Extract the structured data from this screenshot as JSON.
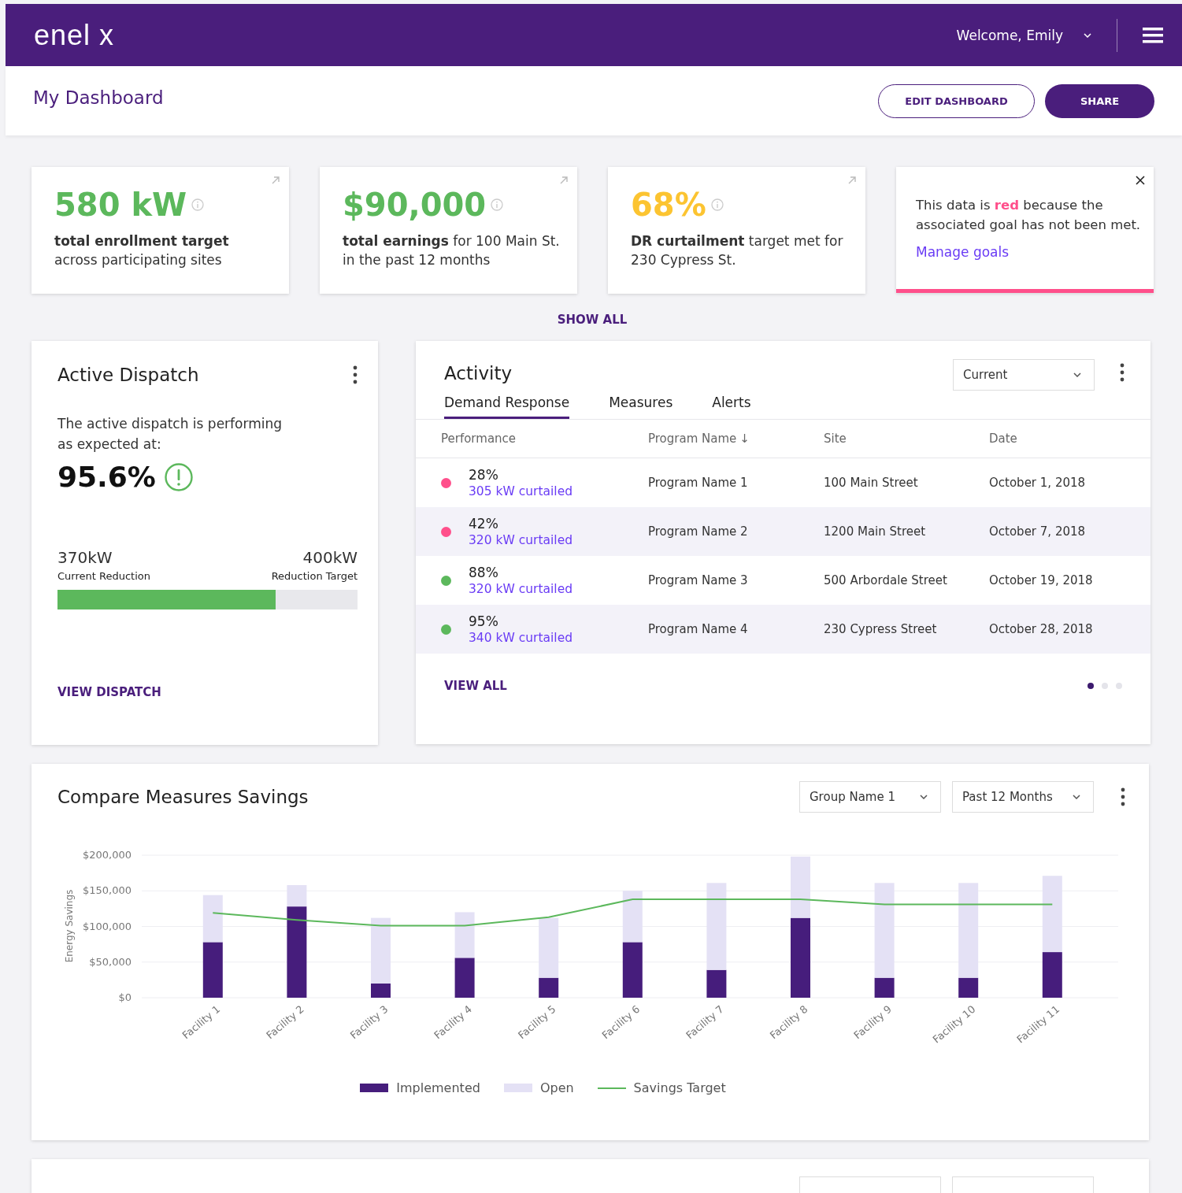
{
  "header": {
    "logo": "enel x",
    "welcome": "Welcome, Emily"
  },
  "page_title": "My Dashboard",
  "actions": [
    {
      "label": "EDIT DASHBOARD",
      "kind": "outline"
    },
    {
      "label": "SHARE",
      "kind": "filled"
    }
  ],
  "kpi_cards": [
    {
      "kind": "metric",
      "value": "580 kW",
      "color": "#5cb85c",
      "description": "**total enrollment target** across participating sites"
    },
    {
      "kind": "metric",
      "value": "$90,000",
      "color": "#5cb85c",
      "description": "**total earnings** for 100 Main St. in the past 12 months"
    },
    {
      "kind": "metric",
      "value": "68%",
      "color": "#fcc431",
      "description": "**DR curtailment** target met for 230 Cypress St."
    },
    {
      "kind": "notice",
      "text_before": "This data is ",
      "highlight": "red",
      "text_after": " because the associated goal has not been met.",
      "link": "Manage goals"
    }
  ],
  "show_all": "SHOW ALL",
  "dispatch": {
    "title": "Active Dispatch",
    "text": "The active dispatch is performing as expected at:",
    "value": "95.6%",
    "current_value": "370kW",
    "current_label": "Current Reduction",
    "target_value": "400kW",
    "target_label": "Reduction Target",
    "level": 0.727,
    "link": "VIEW DISPATCH"
  },
  "activity": {
    "title": "Activity",
    "dropdown": "Current",
    "tabs": [
      {
        "label": "Demand Response",
        "selected": true
      },
      {
        "label": "Measures",
        "selected": false
      },
      {
        "label": "Alerts",
        "selected": false
      }
    ],
    "columns": [
      {
        "label": "Performance"
      },
      {
        "label": "Program Name",
        "sort_icon": "↓"
      },
      {
        "label": "Site"
      },
      {
        "label": "Date"
      }
    ],
    "rows": [
      {
        "color": "#ff4f8b",
        "performance": "28%",
        "curtailed": "305 kW curtailed",
        "program": "Program Name 1",
        "site": "100 Main Street",
        "date": "October 1, 2018"
      },
      {
        "color": "#ff4f8b",
        "performance": "42%",
        "curtailed": "320 kW curtailed",
        "program": "Program Name 2",
        "site": "1200 Main Street",
        "date": "October 7, 2018"
      },
      {
        "color": "#5cb85c",
        "performance": "88%",
        "curtailed": "320 kW curtailed",
        "program": "Program Name 3",
        "site": "500 Arbordale Street",
        "date": "October 19, 2018"
      },
      {
        "color": "#5cb85c",
        "performance": "95%",
        "curtailed": "340 kW curtailed",
        "program": "Program Name 4",
        "site": "230 Cypress Street",
        "date": "October 28, 2018"
      }
    ],
    "link": "VIEW ALL",
    "pages": [
      {
        "selected": true
      },
      {
        "selected": false
      },
      {
        "selected": false
      }
    ]
  },
  "compare": {
    "title": "Compare Measures Savings",
    "dropdowns": [
      "Group Name 1",
      "Past 12 Months"
    ],
    "chart_data": {
      "type": "bar",
      "stacked": true,
      "ylabel": "Energy Savings",
      "categories": [
        "Facility 1",
        "Facility 2",
        "Facility 3",
        "Facility 4",
        "Facility 5",
        "Facility 6",
        "Facility 7",
        "Facility 8",
        "Facility 9",
        "Facility 10",
        "Facility 11"
      ],
      "ylim": [
        0,
        200000
      ],
      "yticks": [
        {
          "value": 0,
          "label": "$0"
        },
        {
          "value": 50000,
          "label": "$50,000"
        },
        {
          "value": 100000,
          "label": "$100,000"
        },
        {
          "value": 150000,
          "label": "$150,000"
        },
        {
          "value": 200000,
          "label": "$200,000"
        }
      ],
      "grid": true,
      "series": [
        {
          "name": "Implemented",
          "color": "#461d7c",
          "values": [
            78000,
            128000,
            20000,
            56000,
            28000,
            78000,
            39000,
            112000,
            28000,
            28000,
            64000
          ]
        },
        {
          "name": "Open",
          "color": "#e4e1f5",
          "values": [
            66000,
            30000,
            92000,
            64000,
            84000,
            72000,
            122000,
            86000,
            133000,
            133000,
            107000
          ]
        },
        {
          "name": "Savings Target",
          "color": "#5cb85c",
          "type": "line",
          "values": [
            119000,
            109000,
            101000,
            101000,
            113000,
            138000,
            138000,
            138000,
            131000,
            131000,
            131000
          ]
        }
      ]
    }
  }
}
